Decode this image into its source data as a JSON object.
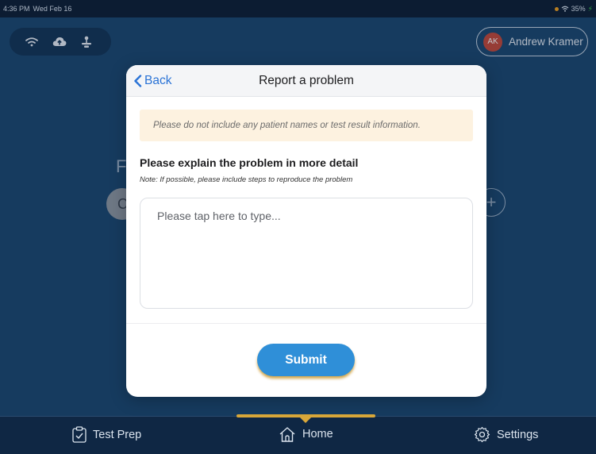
{
  "status_bar": {
    "time": "4:36 PM",
    "date": "Wed Feb 16",
    "battery": "35%"
  },
  "background": {
    "user_initials": "AK",
    "user_name": "Andrew Kramer",
    "partial_letter": "F",
    "partial_pill_letter": "C",
    "plus_glyph": "+"
  },
  "modal": {
    "back_label": "Back",
    "title": "Report a problem",
    "notice": "Please do not include any patient names or test result information.",
    "heading": "Please explain the problem in more detail",
    "note": "Note: If possible, please include steps to reproduce the problem",
    "input_placeholder": "Please tap here to type...",
    "input_value": "",
    "submit_label": "Submit"
  },
  "bottom_nav": {
    "items": [
      {
        "label": "Test Prep",
        "icon": "clipboard-check-icon"
      },
      {
        "label": "Home",
        "icon": "home-icon",
        "active": true
      },
      {
        "label": "Settings",
        "icon": "gear-icon"
      }
    ]
  },
  "colors": {
    "accent": "#2f8fd8",
    "link": "#2a73d6",
    "nav_indicator": "#d9a83a",
    "background": "#17406a",
    "avatar": "#c5483a",
    "notice_bg": "#fdf2e0"
  }
}
